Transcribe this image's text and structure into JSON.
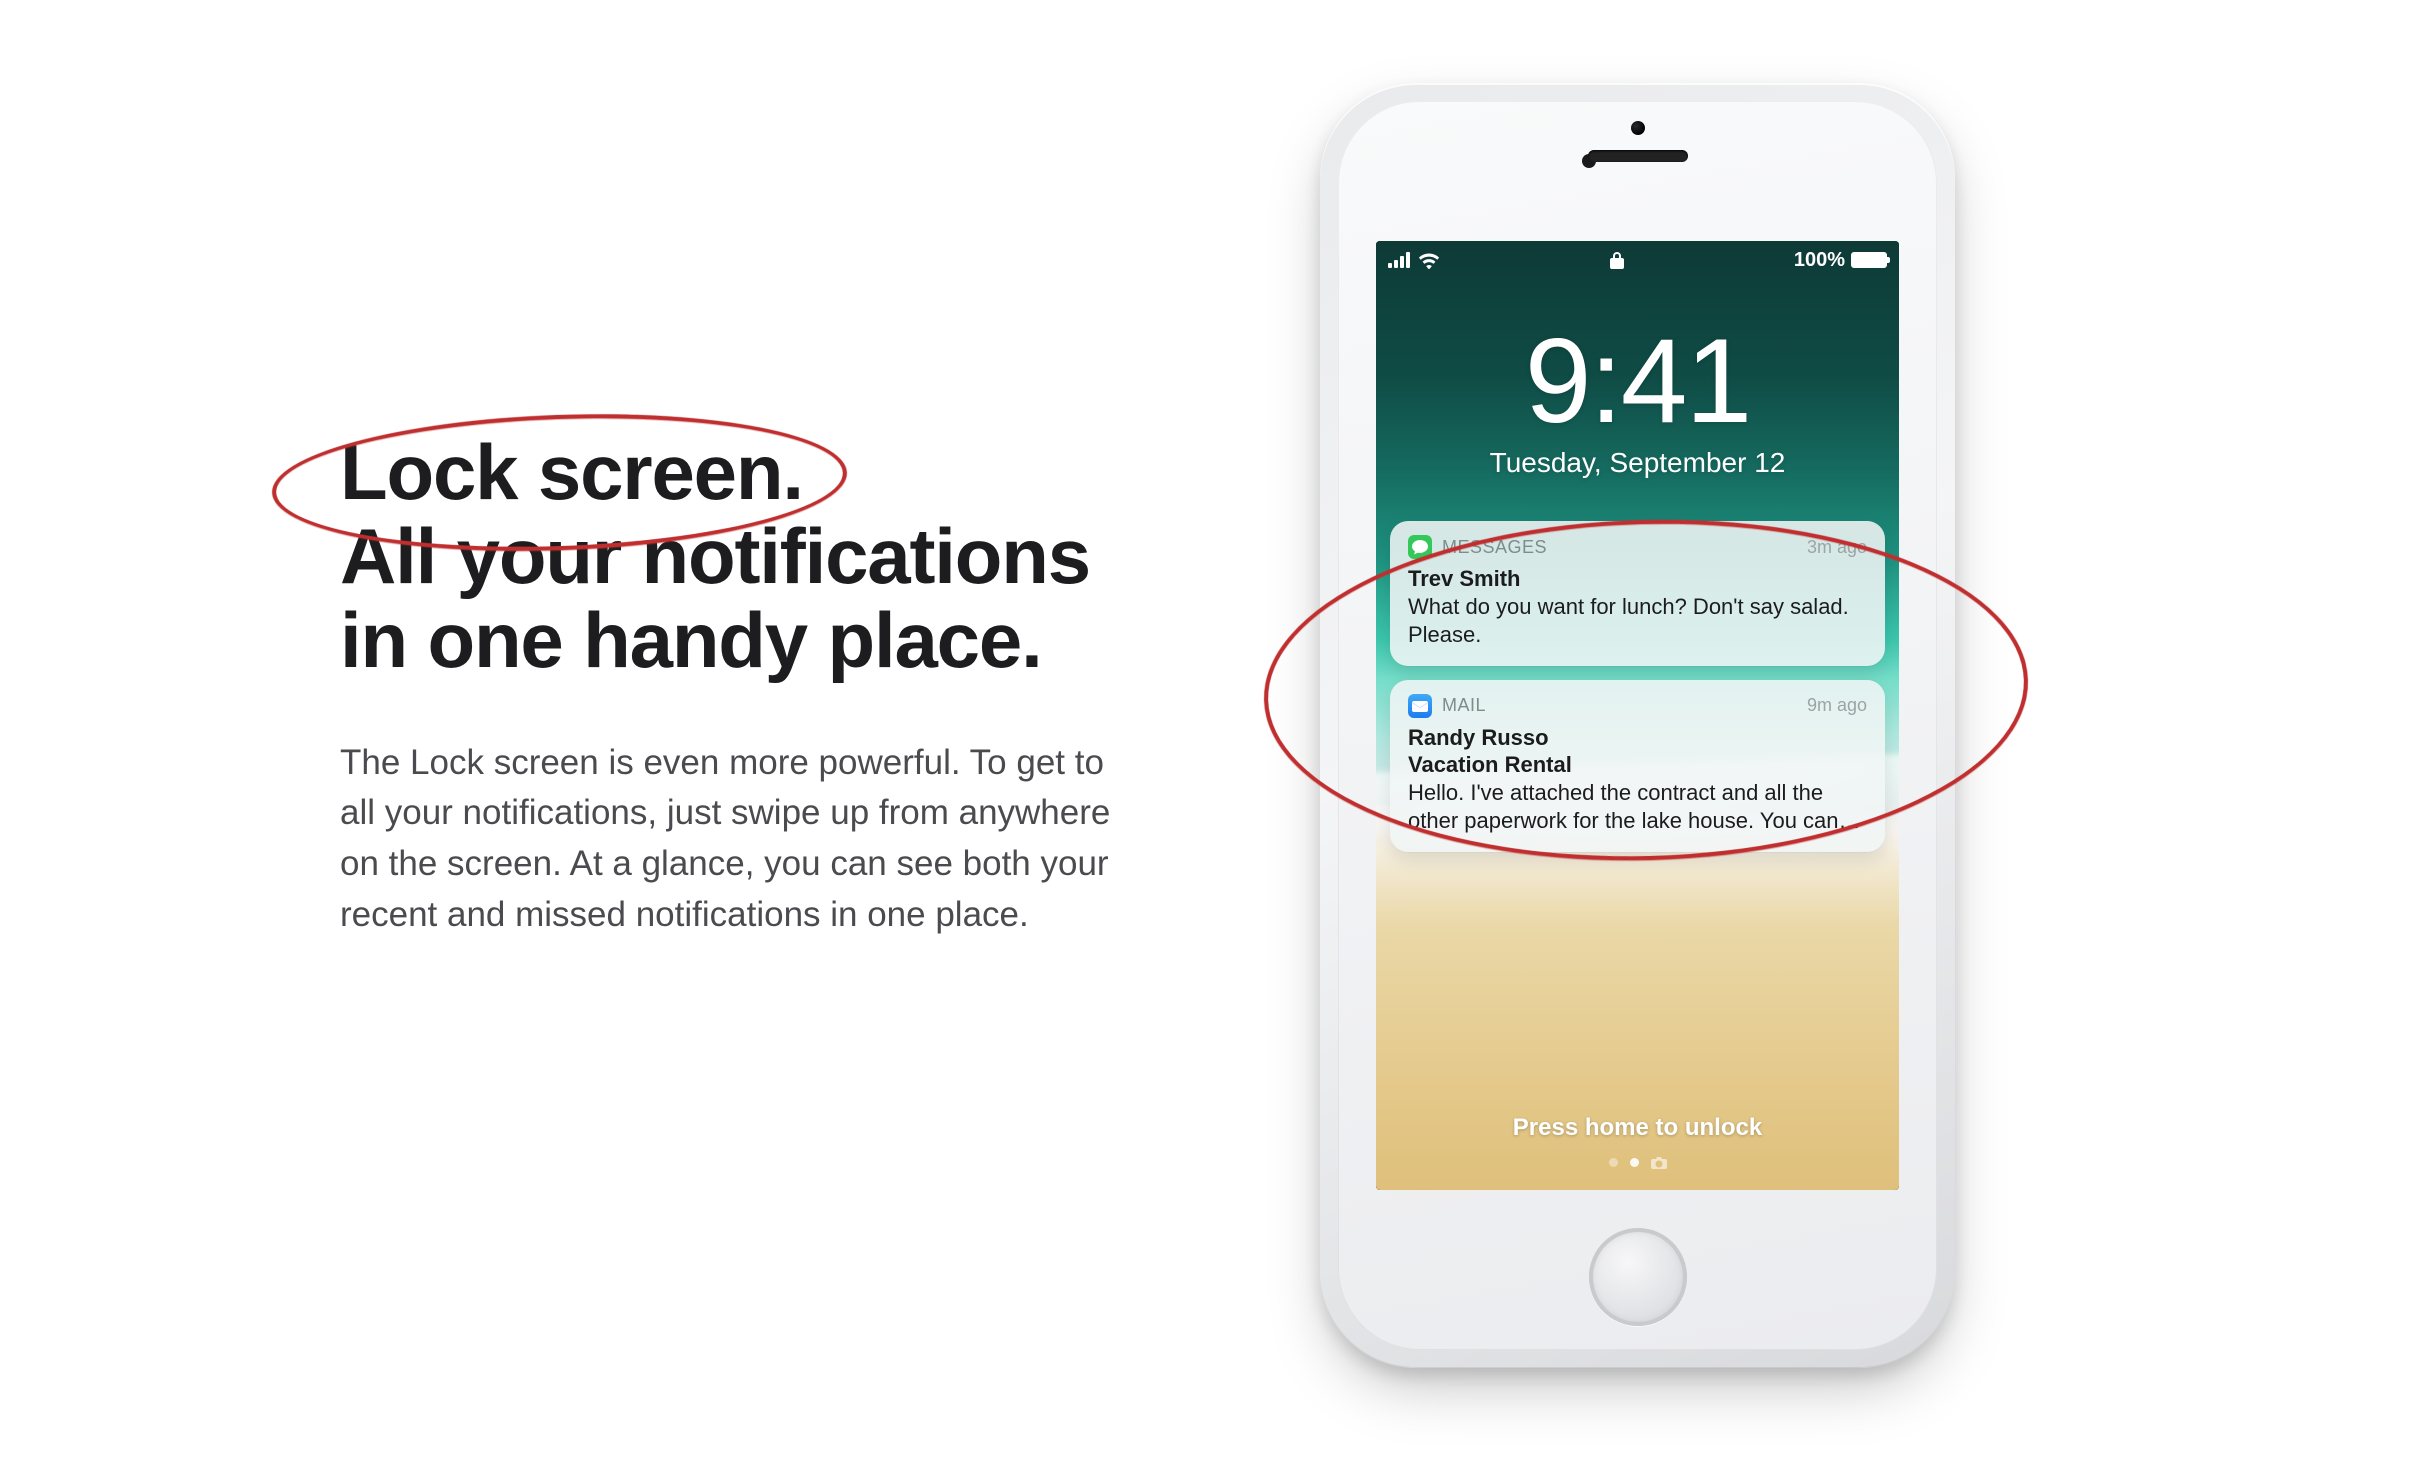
{
  "copy": {
    "heading_line1": "Lock screen.",
    "heading_line2": "All your notifications",
    "heading_line3": "in one handy place.",
    "body": "The Lock screen is even more powerful. To get to all your notifications, just swipe up from anywhere on the screen. At a glance, you can see both your recent and missed notifications in one place."
  },
  "phone": {
    "status": {
      "battery_percent": "100%"
    },
    "lockscreen": {
      "time": "9:41",
      "date": "Tuesday, September 12",
      "unlock_hint": "Press home to unlock"
    },
    "notifications": [
      {
        "app_label": "MESSAGES",
        "time": "3m ago",
        "title": "Trev Smith",
        "subtitle": "",
        "body": "What do you want for lunch? Don't say salad. Please.",
        "icon": "messages"
      },
      {
        "app_label": "MAIL",
        "time": "9m ago",
        "title": "Randy Russo",
        "subtitle": "Vacation Rental",
        "body": "Hello. I've attached the contract and all the other paperwork for the lake house. You can…",
        "icon": "mail"
      }
    ]
  },
  "annotations": {
    "heading_circle": true,
    "notifications_circle": true
  },
  "colors": {
    "annotation": "#c02f2f",
    "messages_icon": "#34c759",
    "mail_icon_bg": "#ffffff",
    "mail_icon_fg": "#1e7cf0"
  }
}
